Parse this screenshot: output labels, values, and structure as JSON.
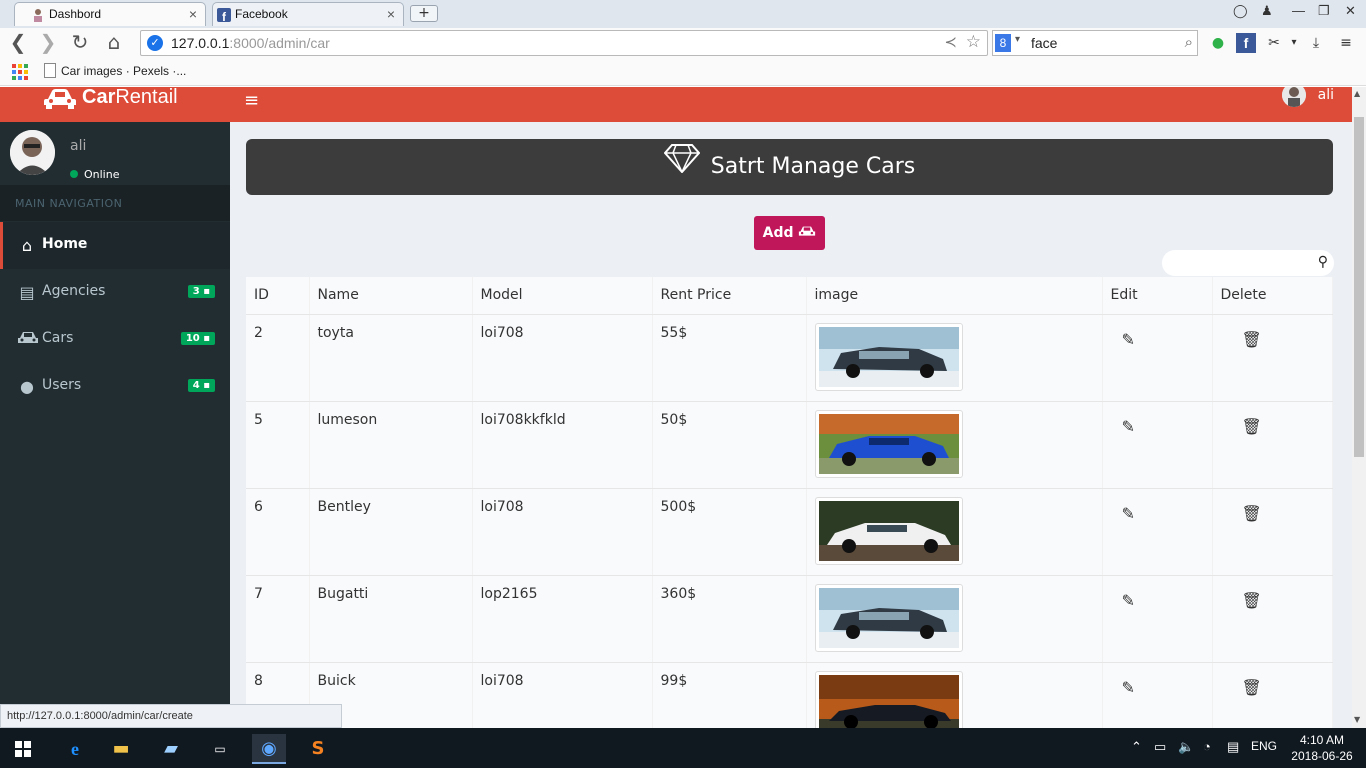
{
  "browser": {
    "tabs": [
      {
        "title": "Dashbord",
        "active": true
      },
      {
        "title": "Facebook",
        "active": false
      }
    ],
    "url_host": "127.0.0.1",
    "url_rest": ":8000/admin/car",
    "search_query": "face",
    "bookmark": "Car images · Pexels ·...",
    "status_url": "http://127.0.0.1:8000/admin/car/create"
  },
  "app": {
    "brand_bold": "Car",
    "brand_light": "Rentail",
    "user": "ali",
    "status": "Online",
    "nav_header": "MAIN NAVIGATION",
    "menu": [
      {
        "label": "Home",
        "icon": "home-icon",
        "badge": ""
      },
      {
        "label": "Agencies",
        "icon": "archive-icon",
        "badge": "3"
      },
      {
        "label": "Cars",
        "icon": "car-icon",
        "badge": "10"
      },
      {
        "label": "Users",
        "icon": "users-icon",
        "badge": "4"
      }
    ],
    "page_title": "Satrt Manage Cars",
    "add_label": "Add",
    "columns": [
      "ID",
      "Name",
      "Model",
      "Rent Price",
      "image",
      "Edit",
      "Delete"
    ],
    "rows": [
      {
        "id": "2",
        "name": "toyta",
        "model": "loi708",
        "price": "55$",
        "image": "dark-suv"
      },
      {
        "id": "5",
        "name": "lumeson",
        "model": "loi708kkfkld",
        "price": "50$",
        "image": "blue-sedan"
      },
      {
        "id": "6",
        "name": "Bentley",
        "model": "loi708",
        "price": "500$",
        "image": "white-sedan"
      },
      {
        "id": "7",
        "name": "Bugatti",
        "model": "lop2165",
        "price": "360$",
        "image": "dark-suv"
      },
      {
        "id": "8",
        "name": "Buick",
        "model": "loi708",
        "price": "99$",
        "image": "black-roadster"
      }
    ]
  },
  "taskbar": {
    "lang": "ENG",
    "time": "4:10 AM",
    "date": "2018-06-26"
  },
  "colors": {
    "header_red": "#dd4b39",
    "sidebar": "#222d32",
    "add_button": "#c0165a",
    "badge_green": "#00a65a"
  }
}
